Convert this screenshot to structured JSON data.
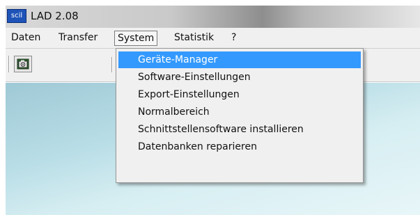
{
  "window": {
    "title": "LAD 2.08",
    "app_icon_text": "scil"
  },
  "menubar": {
    "items": [
      {
        "label": "Daten"
      },
      {
        "label": "Transfer"
      },
      {
        "label": "System"
      },
      {
        "label": "Statistik"
      },
      {
        "label": "?"
      }
    ],
    "open_menu": "System"
  },
  "dropdown": {
    "items": [
      {
        "label": "Geräte-Manager",
        "highlighted": true
      },
      {
        "label": "Software-Einstellungen"
      },
      {
        "label": "Export-Einstellungen"
      },
      {
        "label": "Normalbereich"
      },
      {
        "label": "Schnittstellensoftware installieren"
      },
      {
        "label": "Datenbanken reparieren"
      }
    ]
  },
  "colors": {
    "highlight": "#3399ff",
    "menubar_bg": "#f0f0f0",
    "desktop": "#b8dde6"
  },
  "toolbar": {
    "buttons": [
      {
        "icon": "camera-icon"
      }
    ]
  }
}
